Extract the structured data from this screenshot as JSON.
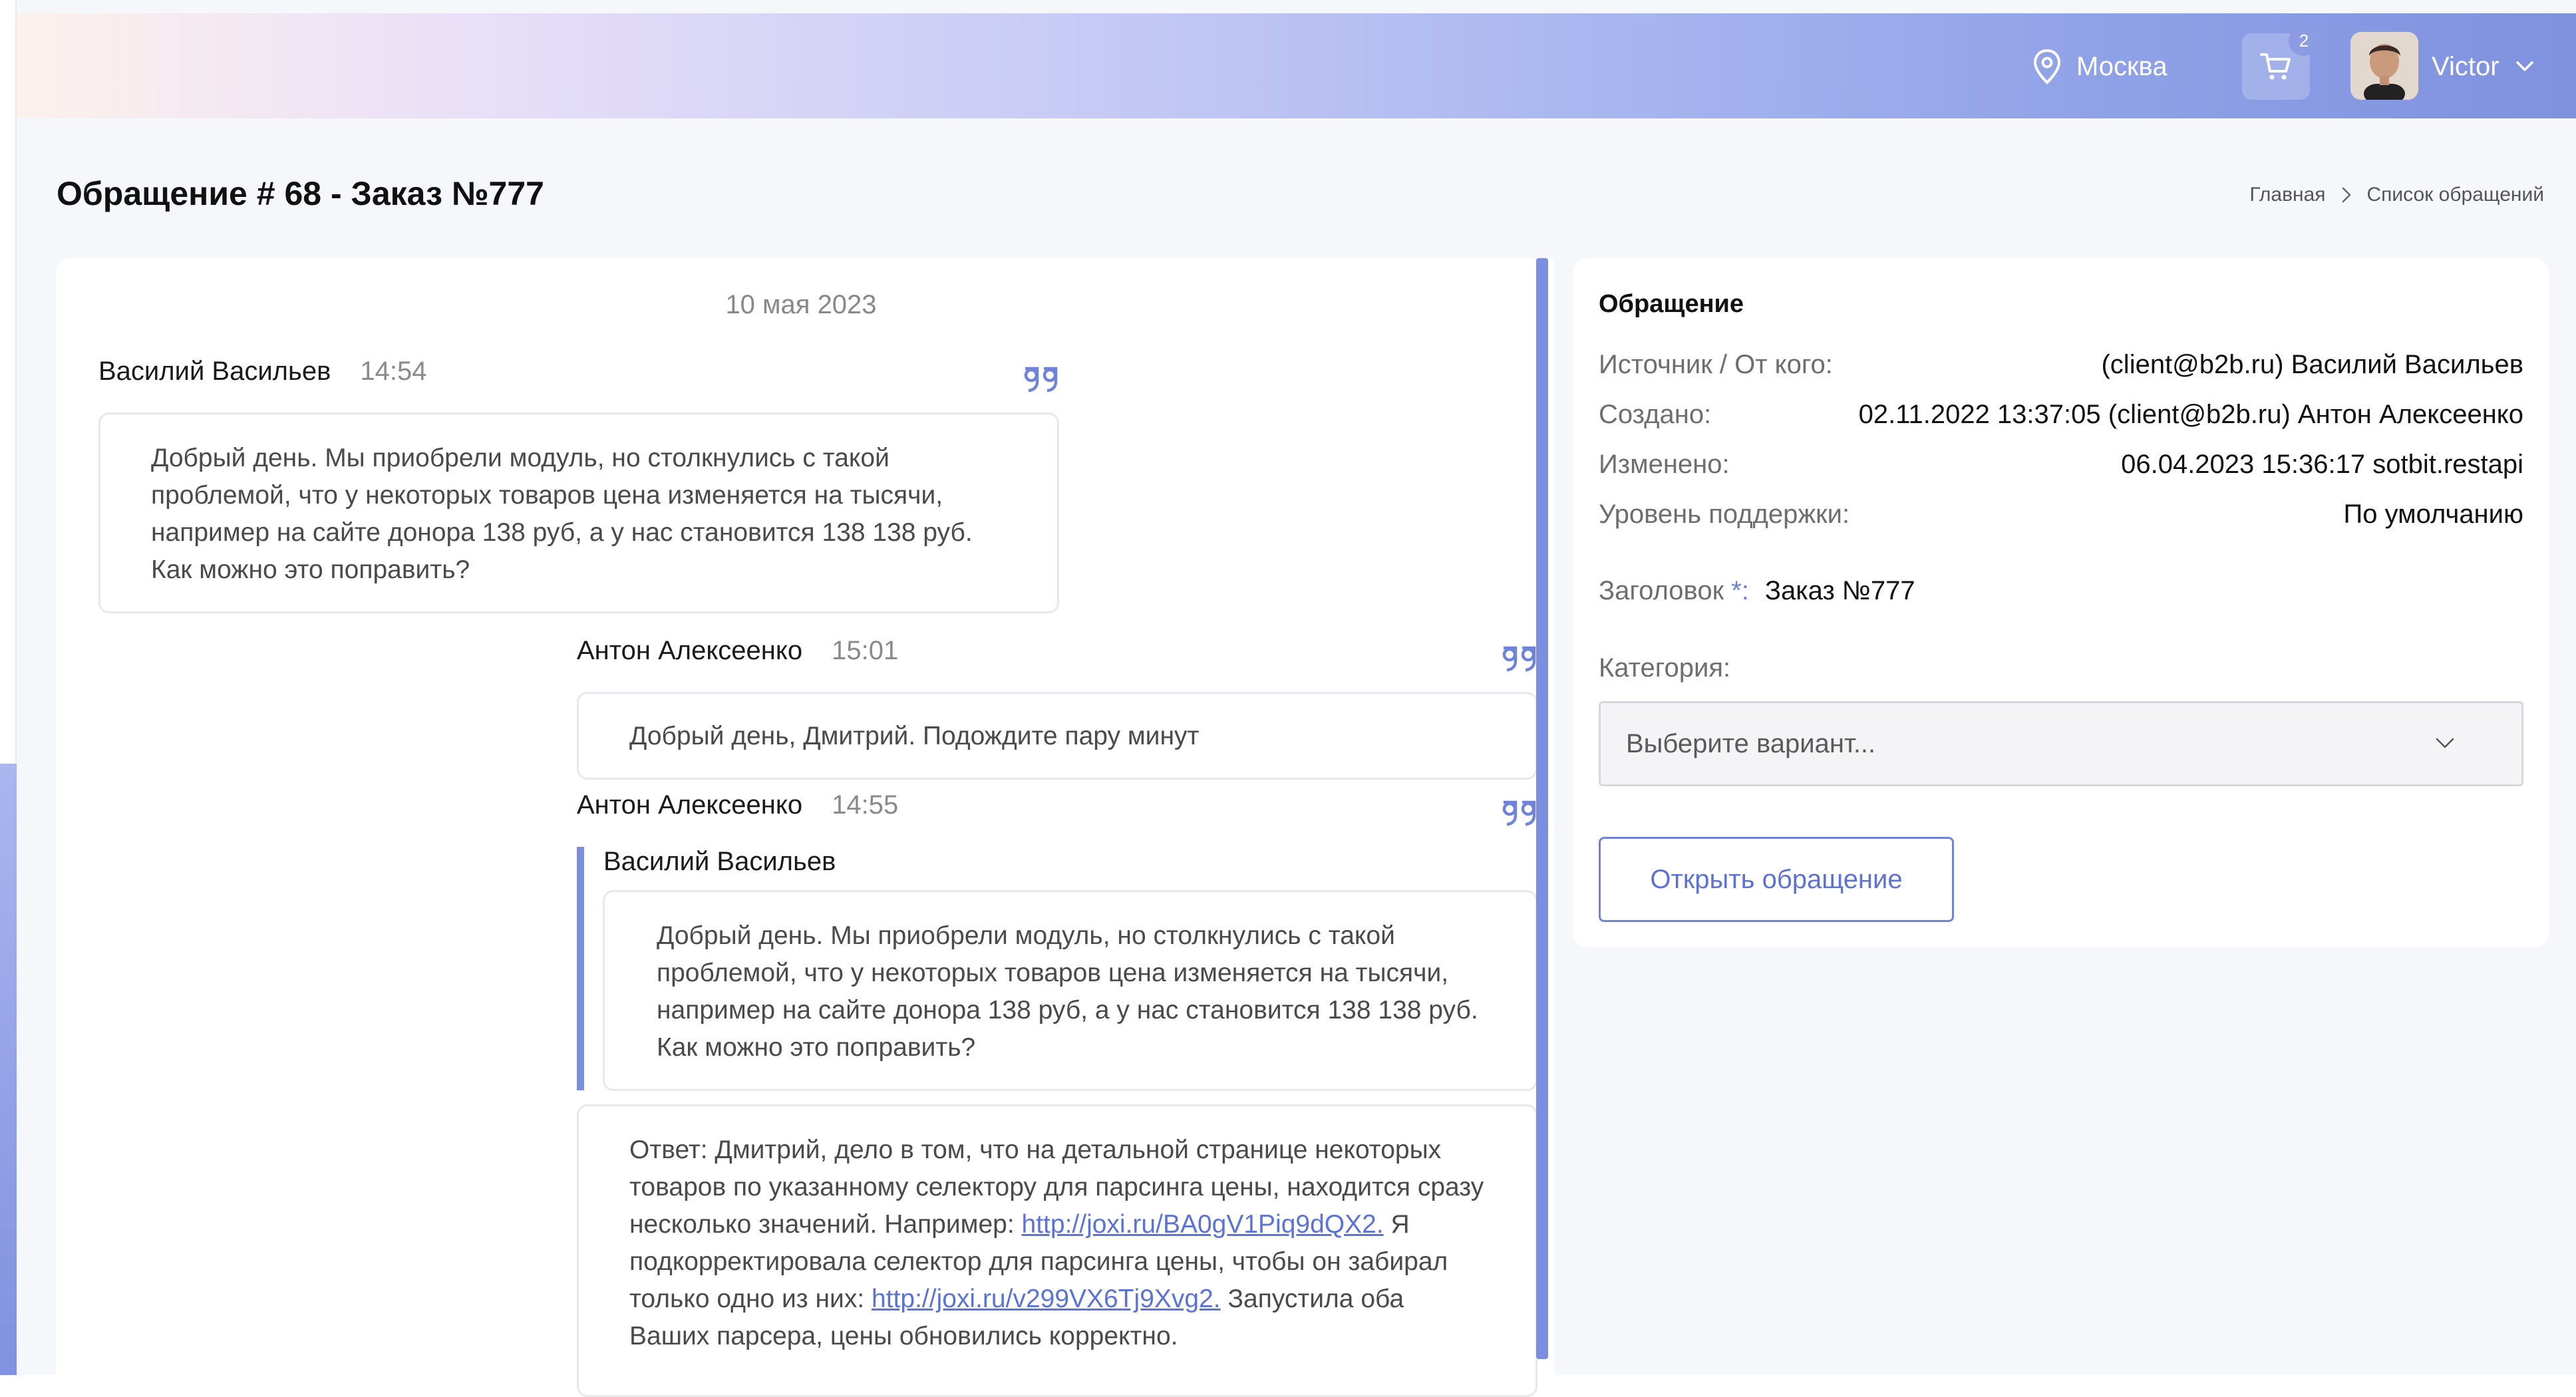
{
  "header": {
    "city": "Москва",
    "cart_count": "2",
    "user_name": "Victor"
  },
  "page": {
    "title": "Обращение # 68 - Заказ №777",
    "breadcrumb": [
      "Главная",
      "Список обращений"
    ]
  },
  "chat": {
    "date": "10 мая 2023",
    "messages": [
      {
        "author": "Василий Васильев",
        "time": "14:54",
        "text": "Добрый день. Мы приобрели модуль, но столкнулись с такой проблемой, что у некоторых товаров цена изменяется на тысячи, например на сайте донора 138 руб, а у нас становится 138 138 руб. Как можно это поправить?"
      },
      {
        "author": "Антон Алексеенко",
        "time": "15:01",
        "text": "Добрый день, Дмитрий. Подождите пару минут"
      },
      {
        "author": "Антон Алексеенко",
        "time": "14:55",
        "quote_author": "Василий Васильев",
        "quote_text": "Добрый день. Мы приобрели модуль, но столкнулись с такой проблемой, что у некоторых товаров цена изменяется на тысячи, например на сайте донора 138 руб, а у нас становится 138 138 руб. Как можно это поправить?",
        "reply_part1": "Ответ: Дмитрий, дело в том, что на детальной странице некоторых товаров по указанному селектору для парсинга цены, находится сразу несколько значений. Например: ",
        "reply_link1": "http://joxi.ru/BA0gV1Piq9dQX2.",
        "reply_part2": " Я подкорректировала селектор для парсинга цены, чтобы он забирал только одно из них: ",
        "reply_link2": "http://joxi.ru/v299VX6Tj9Xvg2.",
        "reply_part3": " Запустила оба Ваших парсера, цены обновились корректно."
      }
    ]
  },
  "info": {
    "title": "Обращение",
    "rows": [
      {
        "label": "Источник / От кого:",
        "value": "(client@b2b.ru) Василий Васильев"
      },
      {
        "label": "Создано:",
        "value": "02.11.2022 13:37:05 (client@b2b.ru) Антон Алексеенко"
      },
      {
        "label": "Изменено:",
        "value": "06.04.2023 15:36:17 sotbit.restapi"
      },
      {
        "label": "Уровень поддержки:",
        "value": "По умолчанию"
      }
    ],
    "subject_label": "Заголовок",
    "subject_star": "*:",
    "subject_value": "Заказ №777",
    "category_label": "Категория:",
    "category_placeholder": "Выберите вариант...",
    "open_button": "Открыть обращение"
  },
  "colors": {
    "accent": "#6f83d8",
    "link": "#5c73d6"
  }
}
